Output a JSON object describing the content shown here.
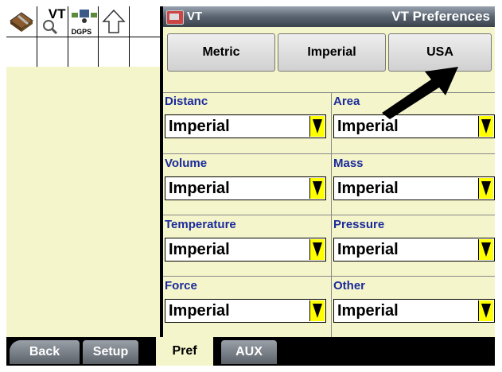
{
  "app": {
    "title_left": "VT",
    "title_right": "VT Preferences"
  },
  "left_panel": {
    "icons": [
      {
        "name": "book-wrench-icon"
      },
      {
        "name": "vt-search-icon",
        "label": "VT"
      },
      {
        "name": "dgps-icon",
        "label": "DGPS"
      },
      {
        "name": "up-arrow-icon"
      }
    ]
  },
  "units": {
    "buttons": [
      "Metric",
      "Imperial",
      "USA"
    ]
  },
  "fields": [
    {
      "label": "Distanc",
      "value": "Imperial"
    },
    {
      "label": "Area",
      "value": "Imperial"
    },
    {
      "label": "Volume",
      "value": "Imperial"
    },
    {
      "label": "Mass",
      "value": "Imperial"
    },
    {
      "label": "Temperature",
      "value": "Imperial"
    },
    {
      "label": "Pressure",
      "value": "Imperial"
    },
    {
      "label": "Force",
      "value": "Imperial"
    },
    {
      "label": "Other",
      "value": "Imperial"
    }
  ],
  "tabs": {
    "back": "Back",
    "setup": "Setup",
    "pref": "Pref",
    "aux": "AUX"
  },
  "colors": {
    "panel_bg": "#f5f5cc",
    "label_blue": "#1a2a9a",
    "dropdown_arrow": "#ffff00",
    "title_bar": "#5a6470"
  }
}
